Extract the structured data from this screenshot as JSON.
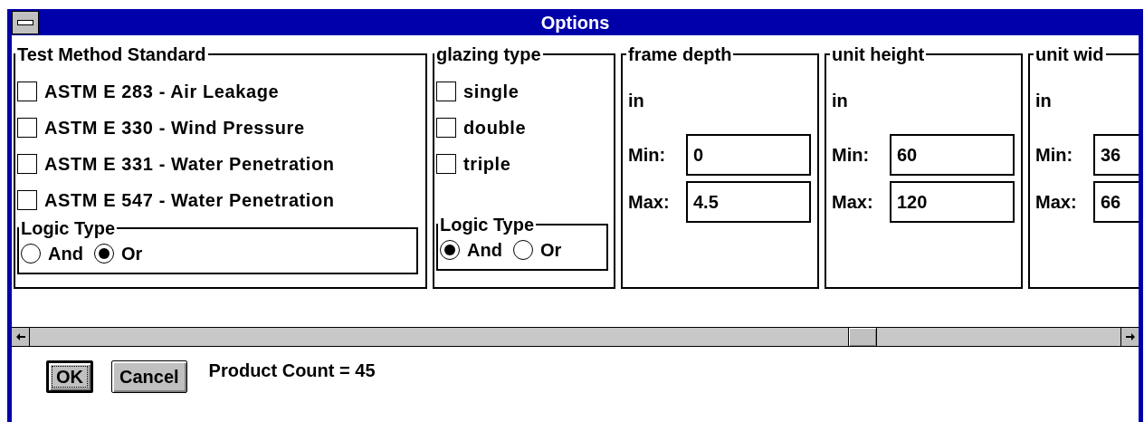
{
  "window": {
    "title": "Options"
  },
  "test_method": {
    "title": "Test Method Standard",
    "options": [
      {
        "label": "ASTM E 283 - Air Leakage",
        "checked": false
      },
      {
        "label": "ASTM E 330 - Wind Pressure",
        "checked": false
      },
      {
        "label": "ASTM E 331 - Water Penetration",
        "checked": false
      },
      {
        "label": "ASTM E 547 - Water Penetration",
        "checked": false
      }
    ],
    "logic": {
      "title": "Logic Type",
      "options": [
        {
          "label": "And",
          "selected": false
        },
        {
          "label": "Or",
          "selected": true
        }
      ]
    }
  },
  "glazing": {
    "title": "glazing type",
    "options": [
      {
        "label": "single",
        "checked": false
      },
      {
        "label": "double",
        "checked": false
      },
      {
        "label": "triple",
        "checked": false
      }
    ],
    "logic": {
      "title": "Logic Type",
      "options": [
        {
          "label": "And",
          "selected": true
        },
        {
          "label": "Or",
          "selected": false
        }
      ]
    }
  },
  "ranges": [
    {
      "title": "frame depth",
      "unit": "in",
      "min_label": "Min:",
      "min": "0",
      "max_label": "Max:",
      "max": "4.5"
    },
    {
      "title": "unit height",
      "unit": "in",
      "min_label": "Min:",
      "min": "60",
      "max_label": "Max:",
      "max": "120"
    },
    {
      "title": "unit wid",
      "unit": "in",
      "min_label": "Min:",
      "min": "36",
      "max_label": "Max:",
      "max": "66"
    }
  ],
  "buttons": [
    {
      "label": "OK",
      "default": true
    },
    {
      "label": "Cancel",
      "default": false
    }
  ],
  "product_count": "Product Count = 45"
}
